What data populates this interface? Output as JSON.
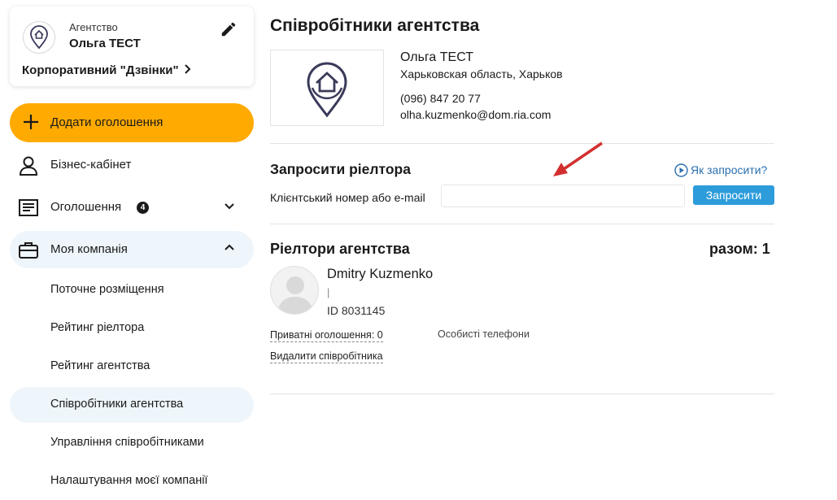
{
  "sidebar": {
    "agency": {
      "kind": "Агентство",
      "name": "Ольга ТЕСТ",
      "tariff": "Корпоративний \"Дзвінки\""
    },
    "add_button": "Додати оголошення",
    "items": [
      {
        "label": "Бізнес-кабінет",
        "icon": "person-icon"
      },
      {
        "label": "Оголошення",
        "icon": "listing-icon",
        "badge": "4"
      },
      {
        "label": "Моя компанія",
        "icon": "briefcase-icon"
      }
    ],
    "company_subitems": [
      "Поточне розміщення",
      "Рейтинг ріелтора",
      "Рейтинг агентства",
      "Співробітники агентства",
      "Управління співробітниками",
      "Налаштування моєї компанії"
    ],
    "accent_color": "#ffaa00",
    "active_bg_color": "#eef6fb"
  },
  "main": {
    "title": "Співробітники агентства",
    "company": {
      "name": "Ольга ТЕСТ",
      "region": "Харьковская область, Харьков",
      "phone": "(096) 847 20 77",
      "email": "olha.kuzmenko@dom.ria.com"
    },
    "invite": {
      "title": "Запросити ріелтора",
      "how_link": "Як запросити?",
      "label": "Клієнтський номер або e-mail",
      "input_value": "",
      "button": "Запросити",
      "button_color": "#2d9cdb"
    },
    "realtors": {
      "title": "Ріелтори агентства",
      "total_label": "разом:",
      "total": "1",
      "list": [
        {
          "name": "Dmitry Kuzmenko",
          "sub": "|",
          "id": "ID 8031145",
          "private_listings": "Приватні оголошення: 0",
          "phones_label": "Особисті телефони",
          "delete": "Видалити співробітника"
        }
      ]
    }
  }
}
